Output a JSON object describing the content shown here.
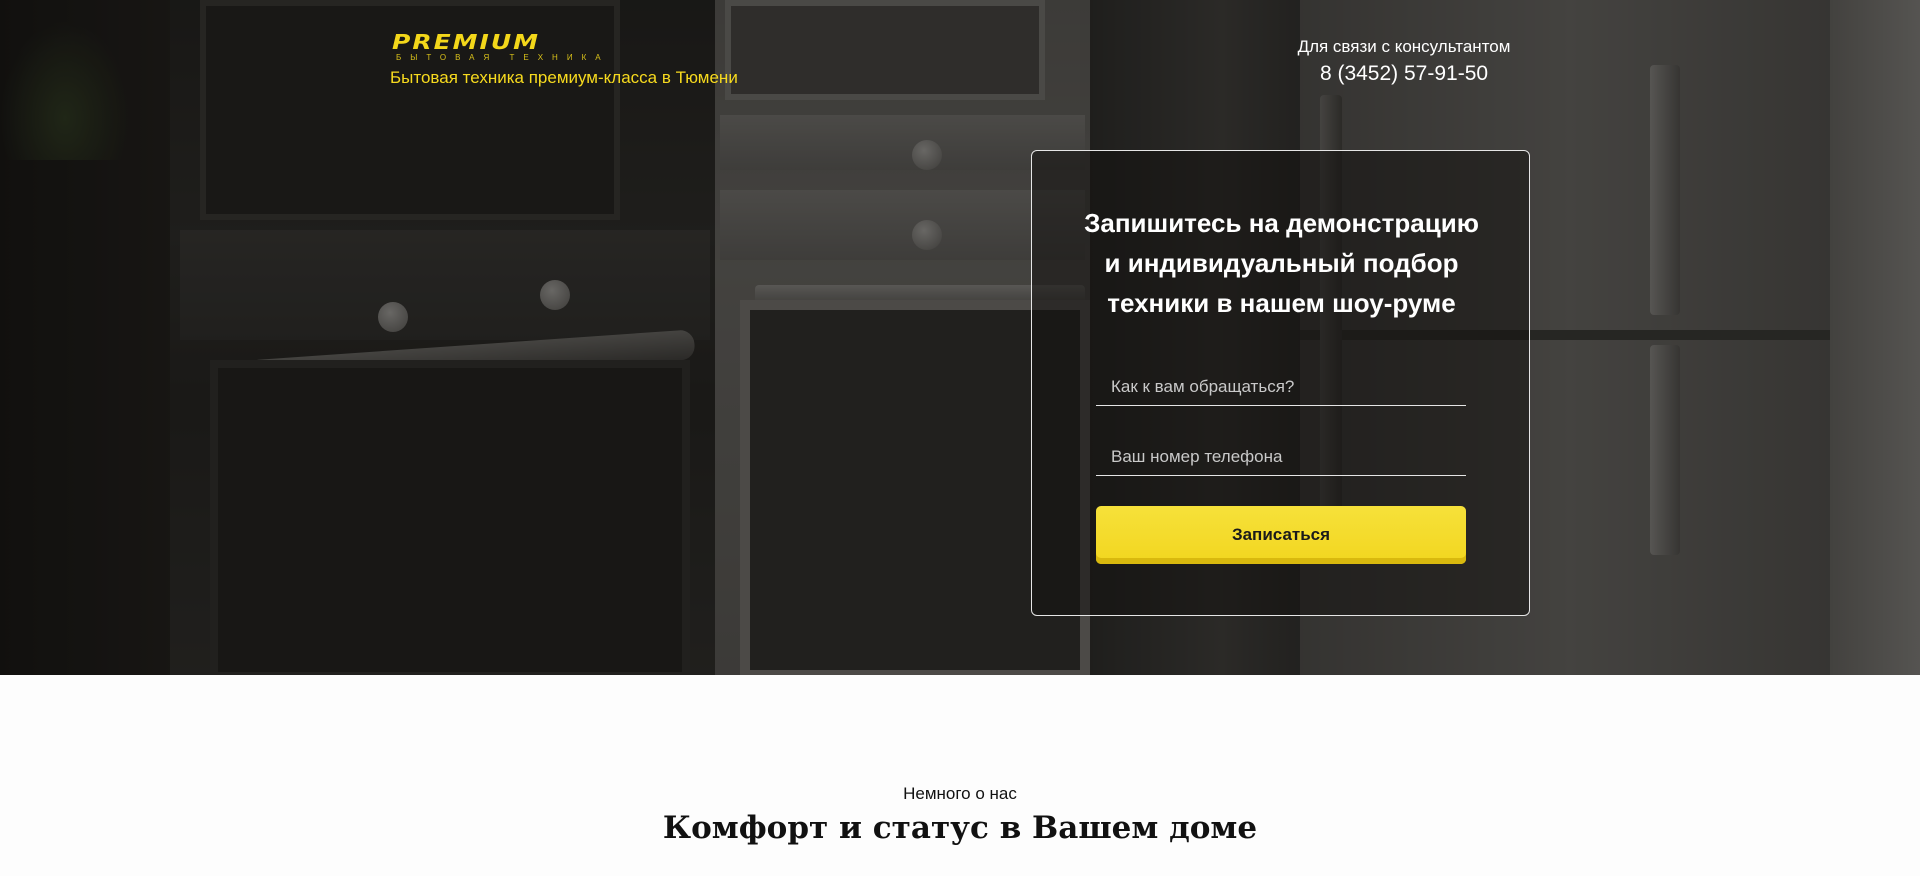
{
  "header": {
    "logo_text": "PREMIUM",
    "logo_subtext": "БЫТОВАЯ ТЕХНИКА",
    "tagline": "Бытовая техника премиум-класса в Тюмени",
    "contact_label": "Для связи с консультантом",
    "contact_phone": "8 (3452) 57-91-50"
  },
  "form": {
    "title_line1": "Запишитесь на демонстрацию",
    "title_line2": "и индивидуальный подбор",
    "title_line3": "техники в нашем шоу-руме",
    "name_placeholder": "Как к вам обращаться?",
    "phone_placeholder": "Ваш номер телефона",
    "submit_label": "Записаться"
  },
  "about": {
    "kicker": "Немного о нас",
    "title": "Комфорт и статус в Вашем доме"
  },
  "colors": {
    "accent_yellow": "#f3d71a",
    "button_yellow": "#f2d61f",
    "text_white": "#ffffff",
    "text_dark": "#111111"
  }
}
